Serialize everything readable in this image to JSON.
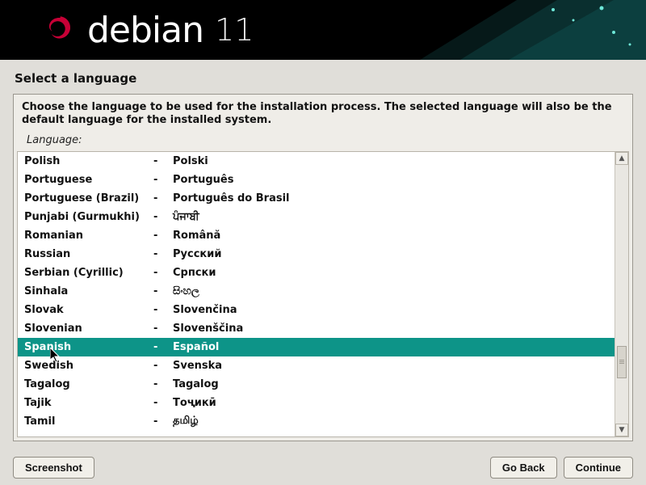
{
  "brand": {
    "name": "debian",
    "version": "11"
  },
  "title": "Select a language",
  "instructions": "Choose the language to be used for the installation process. The selected language will also be the default language for the installed system.",
  "field_label": "Language:",
  "selected_index": 10,
  "languages": [
    {
      "en": "Polish",
      "native": "Polski"
    },
    {
      "en": "Portuguese",
      "native": "Português"
    },
    {
      "en": "Portuguese (Brazil)",
      "native": "Português do Brasil"
    },
    {
      "en": "Punjabi (Gurmukhi)",
      "native": "ਪੰਜਾਬੀ"
    },
    {
      "en": "Romanian",
      "native": "Română"
    },
    {
      "en": "Russian",
      "native": "Русский"
    },
    {
      "en": "Serbian (Cyrillic)",
      "native": "Српски"
    },
    {
      "en": "Sinhala",
      "native": "සිංහල"
    },
    {
      "en": "Slovak",
      "native": "Slovenčina"
    },
    {
      "en": "Slovenian",
      "native": "Slovenščina"
    },
    {
      "en": "Spanish",
      "native": "Español"
    },
    {
      "en": "Swedish",
      "native": "Svenska"
    },
    {
      "en": "Tagalog",
      "native": "Tagalog"
    },
    {
      "en": "Tajik",
      "native": "Тоҷикӣ"
    },
    {
      "en": "Tamil",
      "native": "தமிழ்"
    }
  ],
  "dash": "-",
  "buttons": {
    "screenshot": "Screenshot",
    "go_back": "Go Back",
    "continue": "Continue"
  },
  "colors": {
    "selection": "#0d9488",
    "background": "#e0ded9",
    "banner": "#000000"
  }
}
